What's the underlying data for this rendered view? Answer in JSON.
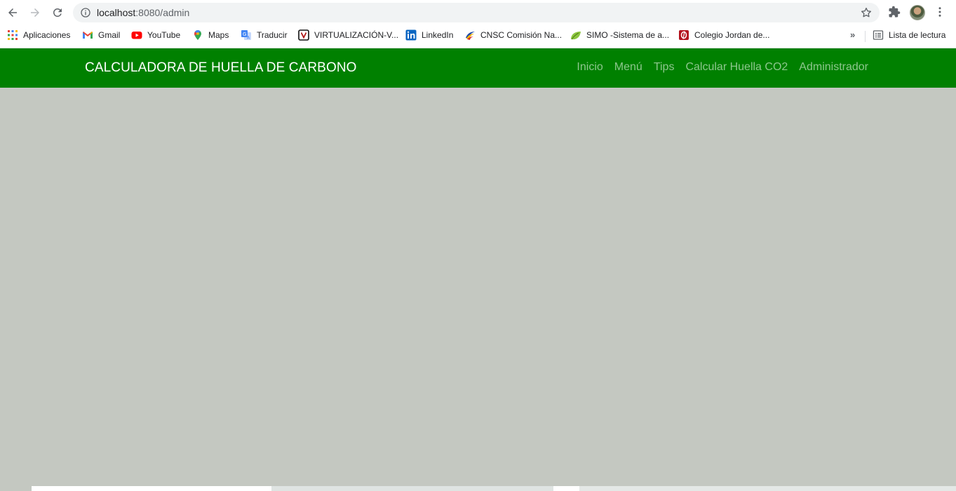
{
  "browser": {
    "url_host": "localhost",
    "url_path": ":8080/admin",
    "bookmarks": [
      {
        "label": "Aplicaciones",
        "icon": "apps-grid-icon"
      },
      {
        "label": "Gmail",
        "icon": "gmail-icon"
      },
      {
        "label": "YouTube",
        "icon": "youtube-icon"
      },
      {
        "label": "Maps",
        "icon": "maps-pin-icon"
      },
      {
        "label": "Traducir",
        "icon": "translate-icon"
      },
      {
        "label": "VIRTUALIZACIÓN-V...",
        "icon": "virtualizacion-icon"
      },
      {
        "label": "LinkedIn",
        "icon": "linkedin-icon"
      },
      {
        "label": "CNSC Comisión Na...",
        "icon": "cnsc-icon"
      },
      {
        "label": "SIMO -Sistema de a...",
        "icon": "simo-leaf-icon"
      },
      {
        "label": "Colegio Jordan de...",
        "icon": "colegio-icon"
      }
    ],
    "more_bookmarks": "»",
    "reading_list": "Lista de lectura"
  },
  "page": {
    "brand": "CALCULADORA DE HUELLA DE CARBONO",
    "nav": [
      {
        "label": "Inicio"
      },
      {
        "label": "Menú"
      },
      {
        "label": "Tips"
      },
      {
        "label": "Calcular Huella CO2"
      },
      {
        "label": "Administrador"
      }
    ],
    "colors": {
      "navbar": "#008000",
      "background": "#c4c8c1"
    }
  }
}
